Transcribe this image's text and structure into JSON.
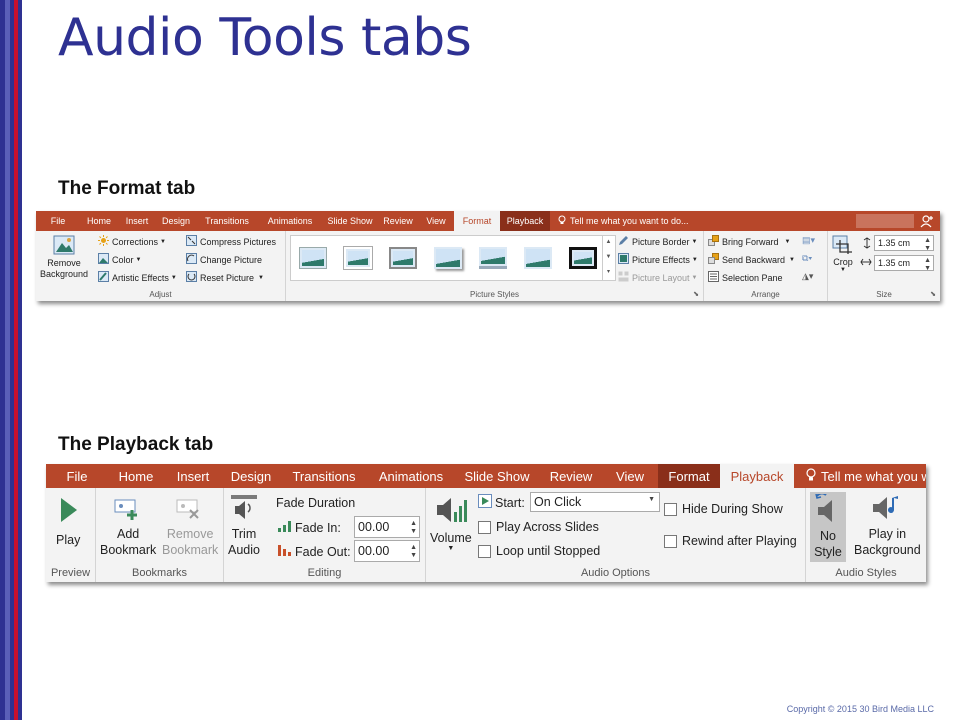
{
  "slide": {
    "title": "Audio Tools tabs",
    "format_label": "The Format tab",
    "playback_label": "The Playback tab",
    "copyright": "Copyright © 2015 30 Bird Media LLC"
  },
  "format_ribbon": {
    "tabs": [
      "File",
      "Home",
      "Insert",
      "Design",
      "Transitions",
      "Animations",
      "Slide Show",
      "Review",
      "View",
      "Format",
      "Playback"
    ],
    "active_tab": "Format",
    "tell_me": "Tell me what you want to do...",
    "adjust": {
      "remove_background": "Remove Background",
      "corrections": "Corrections",
      "color": "Color",
      "artistic_effects": "Artistic Effects",
      "compress_pictures": "Compress Pictures",
      "change_picture": "Change Picture",
      "reset_picture": "Reset Picture",
      "label": "Adjust"
    },
    "picture_styles": {
      "label": "Picture Styles",
      "picture_border": "Picture Border",
      "picture_effects": "Picture Effects",
      "picture_layout": "Picture Layout"
    },
    "arrange": {
      "bring_forward": "Bring Forward",
      "send_backward": "Send Backward",
      "selection_pane": "Selection Pane",
      "label": "Arrange"
    },
    "size": {
      "crop": "Crop",
      "height": "1.35 cm",
      "width": "1.35 cm",
      "label": "Size"
    }
  },
  "playback_ribbon": {
    "tabs": [
      "File",
      "Home",
      "Insert",
      "Design",
      "Transitions",
      "Animations",
      "Slide Show",
      "Review",
      "View",
      "Format",
      "Playback"
    ],
    "active_tab": "Playback",
    "tell_me": "Tell me what you w",
    "preview": {
      "play": "Play",
      "label": "Preview"
    },
    "bookmarks": {
      "add": "Add Bookmark",
      "add_1": "Add",
      "add_2": "Bookmark",
      "remove_1": "Remove",
      "remove_2": "Bookmark",
      "label": "Bookmarks"
    },
    "editing": {
      "trim_1": "Trim",
      "trim_2": "Audio",
      "fade_duration": "Fade Duration",
      "fade_in_label": "Fade In:",
      "fade_in_value": "00.00",
      "fade_out_label": "Fade Out:",
      "fade_out_value": "00.00",
      "label": "Editing"
    },
    "audio_options": {
      "volume": "Volume",
      "start_label": "Start:",
      "start_value": "On Click",
      "play_across_slides": "Play Across Slides",
      "loop_until_stopped": "Loop until Stopped",
      "hide_during_show": "Hide During Show",
      "rewind_after_playing": "Rewind after Playing",
      "label": "Audio Options"
    },
    "audio_styles": {
      "no_style_1": "No",
      "no_style_2": "Style",
      "play_bg_1": "Play in",
      "play_bg_2": "Background",
      "label": "Audio Styles"
    }
  },
  "colors": {
    "title": "#2e3192",
    "tab_bar": "#b7472a",
    "accent_green": "#2e7a6b"
  }
}
